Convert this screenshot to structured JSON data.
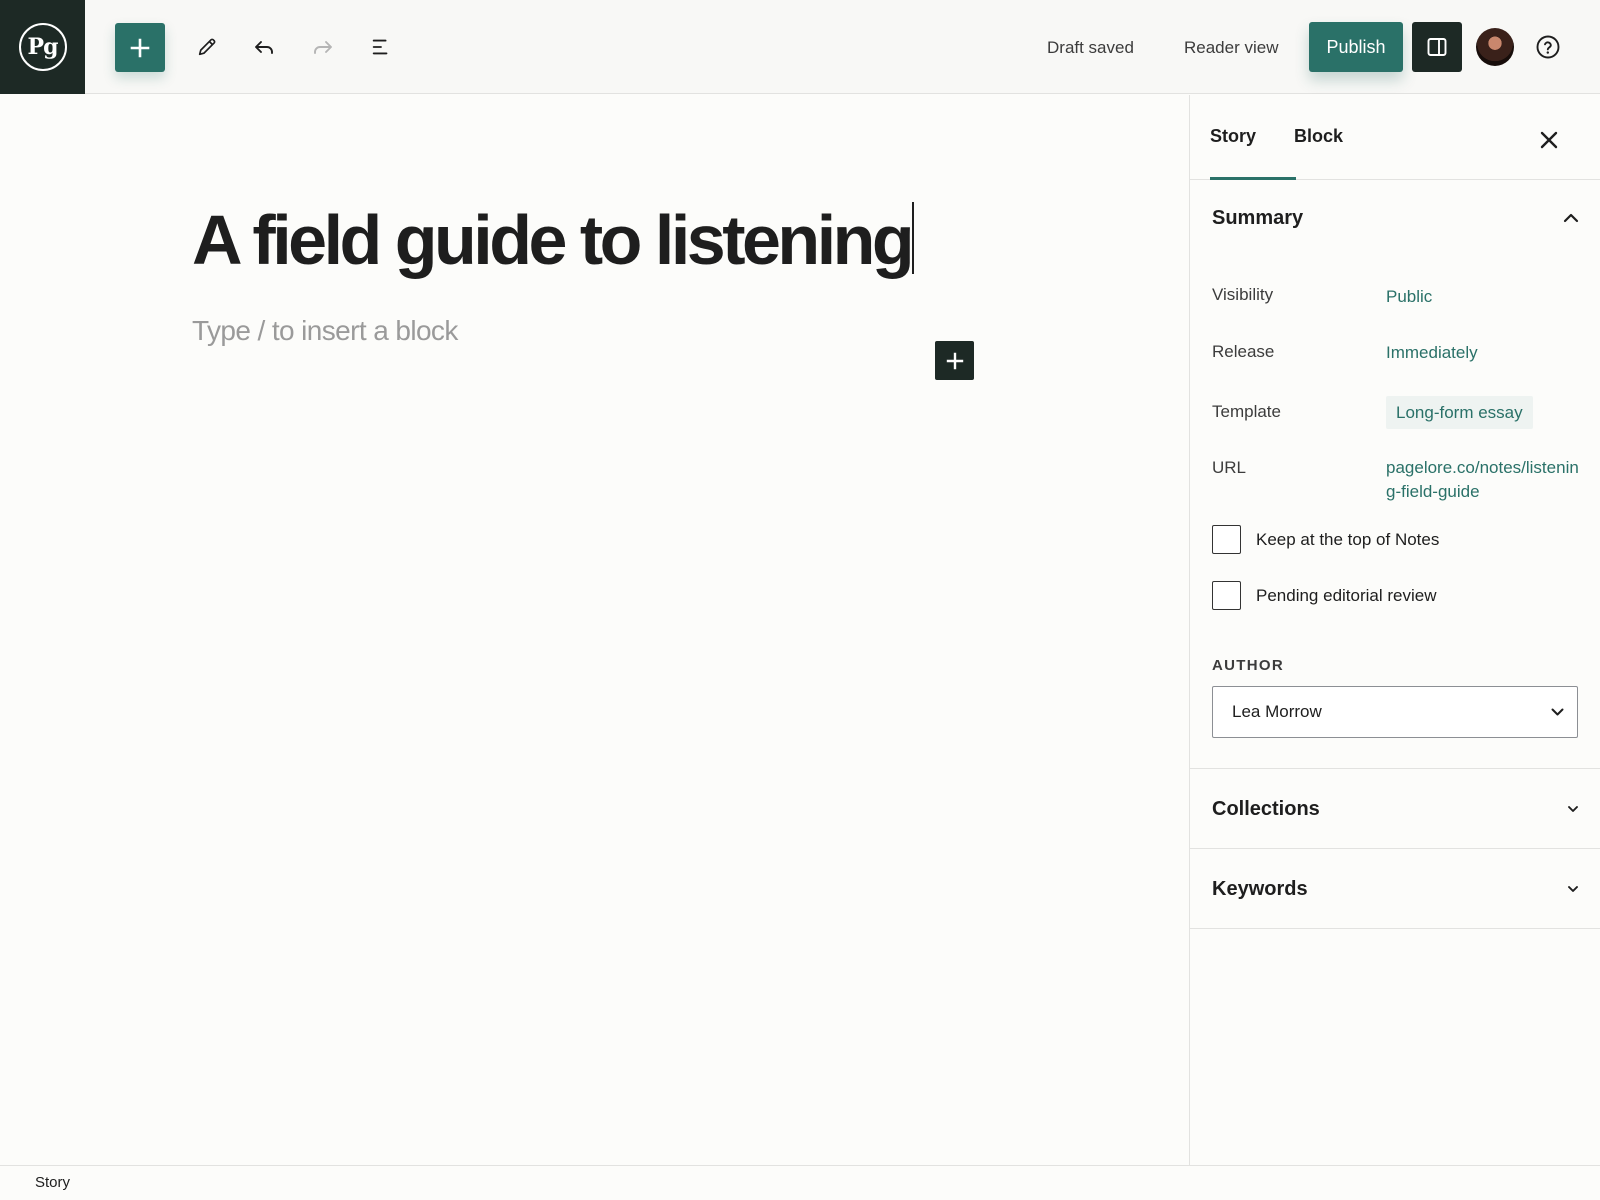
{
  "brand": {
    "logo_text": "Pg"
  },
  "toolbar": {
    "add_block_icon": "plus-icon",
    "tools_icon": "pencil-icon",
    "undo_icon": "undo-icon",
    "redo_icon": "redo-icon",
    "outline_icon": "list-view-icon",
    "draft_status": "Draft saved",
    "reader_view_label": "Reader view",
    "publish_label": "Publish",
    "settings_icon": "sidebar-toggle-icon",
    "help_icon": "help-icon",
    "accent_color": "#2a7168",
    "dark_color": "#1d2925"
  },
  "editor": {
    "title": "A field guide to listening",
    "block_placeholder": "Type / to insert a block"
  },
  "sidebar": {
    "tabs": [
      {
        "label": "Story",
        "active": true
      },
      {
        "label": "Block",
        "active": false
      }
    ],
    "summary": {
      "title": "Summary",
      "expanded": true,
      "visibility_label": "Visibility",
      "visibility_value": "Public",
      "release_label": "Release",
      "release_value": "Immediately",
      "template_label": "Template",
      "template_value": "Long-form essay",
      "url_label": "URL",
      "url_value": "pagelore.co/notes/listening-field-guide",
      "sticky_label": "Keep at the top of Notes",
      "sticky_checked": false,
      "pending_label": "Pending editorial review",
      "pending_checked": false,
      "author_caption": "AUTHOR",
      "author_value": "Lea Morrow"
    },
    "collections": {
      "title": "Collections",
      "expanded": false
    },
    "keywords": {
      "title": "Keywords",
      "expanded": false
    }
  },
  "footer": {
    "breadcrumb": "Story"
  }
}
